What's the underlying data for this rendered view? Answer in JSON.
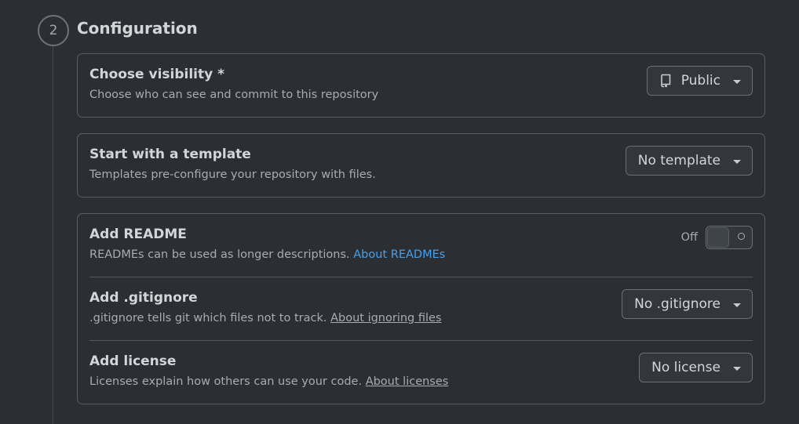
{
  "step": {
    "number": "2",
    "title": "Configuration"
  },
  "visibility": {
    "title": "Choose visibility *",
    "description": "Choose who can see and commit to this repository",
    "selected": "Public",
    "icon": "repo-icon"
  },
  "template": {
    "title": "Start with a template",
    "description": "Templates pre-configure your repository with files.",
    "selected": "No template"
  },
  "readme": {
    "title": "Add README",
    "description": "READMEs can be used as longer descriptions.",
    "link": "About READMEs",
    "toggle_label": "Off",
    "toggle_state": "off"
  },
  "gitignore": {
    "title": "Add .gitignore",
    "description": ".gitignore tells git which files not to track.",
    "link": "About ignoring files",
    "selected": "No .gitignore"
  },
  "license": {
    "title": "Add license",
    "description": "Licenses explain how others can use your code.",
    "link": "About licenses",
    "selected": "No license"
  },
  "colors": {
    "background": "#2b2f33",
    "link": "#4b9fe6",
    "border": "#5a5f64"
  }
}
